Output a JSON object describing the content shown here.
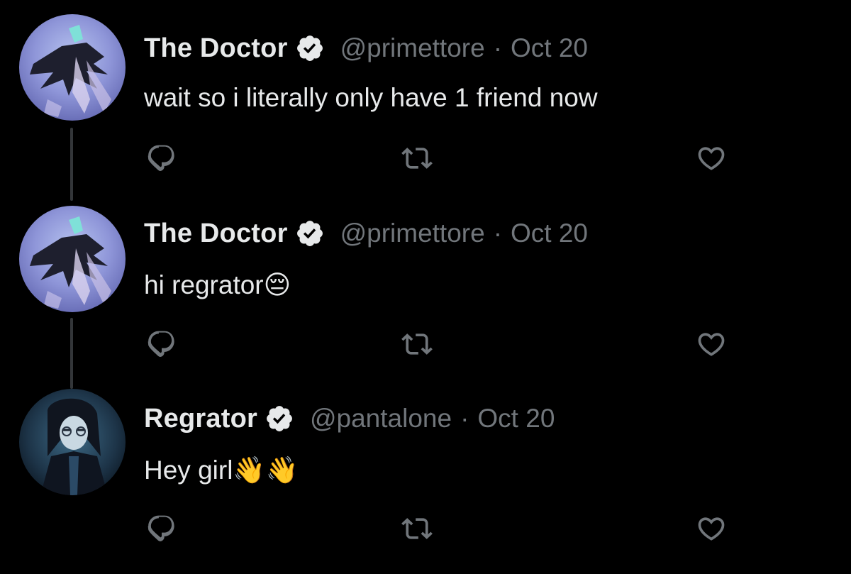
{
  "tweets": [
    {
      "author": "The Doctor",
      "handle": "@primettore",
      "separator": "·",
      "date": "Oct 20",
      "text": "wait so i literally only have 1 friend now",
      "verified": true,
      "avatar_icon": "doctor-avatar"
    },
    {
      "author": "The Doctor",
      "handle": "@primettore",
      "separator": "·",
      "date": "Oct 20",
      "text": "hi regrator😔",
      "verified": true,
      "avatar_icon": "doctor-avatar"
    },
    {
      "author": "Regrator",
      "handle": "@pantalone",
      "separator": "·",
      "date": "Oct 20",
      "text": "Hey girl👋👋",
      "verified": true,
      "avatar_icon": "regrator-avatar"
    }
  ],
  "icons": {
    "reply": "reply-icon",
    "retweet": "retweet-icon",
    "like": "like-icon",
    "verified": "verified-badge-icon"
  },
  "colors": {
    "background": "#000000",
    "primary_text": "#e7e9ea",
    "secondary_text": "#71767b",
    "thread_line": "#333639"
  }
}
